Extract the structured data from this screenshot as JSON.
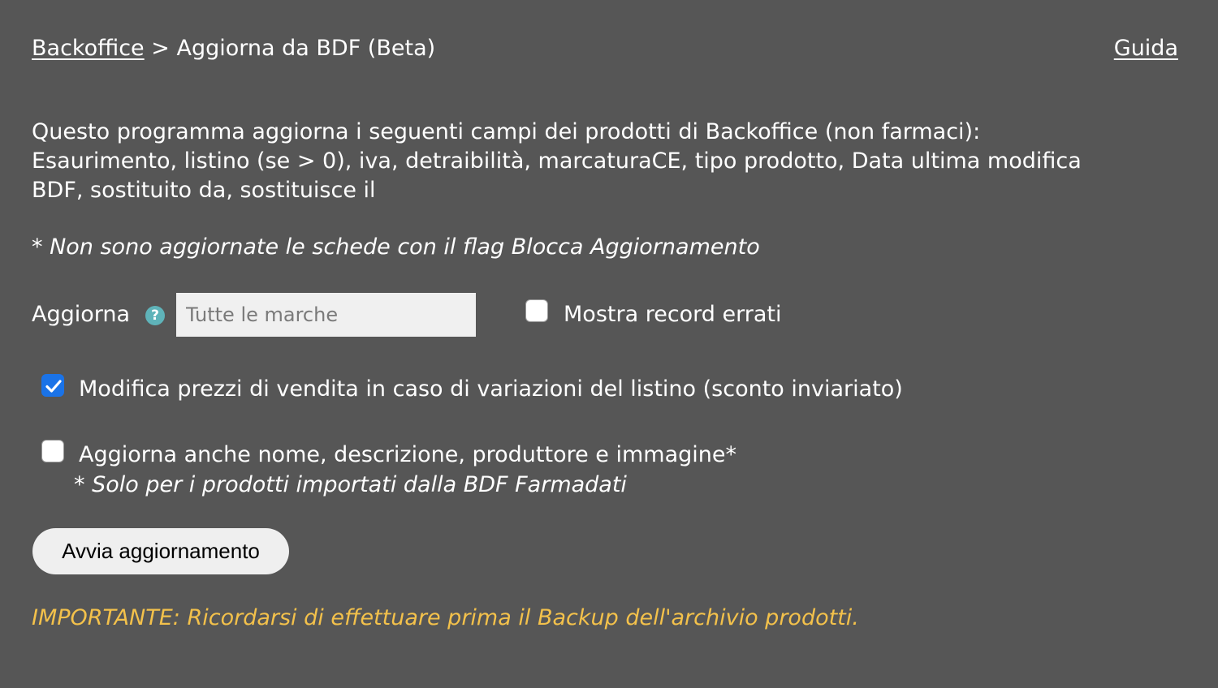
{
  "breadcrumb": {
    "root_label": "Backoffice",
    "separator": ">",
    "current": "Aggiorna da BDF (Beta)"
  },
  "guide_link": "Guida",
  "intro": {
    "line1": "Questo programma aggiorna i seguenti campi dei prodotti di Backoffice (non farmaci):",
    "line2": "Esaurimento, listino (se > 0), iva, detraibilità, marcaturaCE, tipo prodotto, Data ultima modifica",
    "line3": "BDF, sostituito da, sostituisce il"
  },
  "note_block_update": "* Non sono aggiornate le schede con il flag Blocca Aggiornamento",
  "update_row": {
    "label": "Aggiorna",
    "help_icon": "help-icon",
    "help_glyph": "?",
    "brand_placeholder": "Tutte le marche",
    "brand_value": ""
  },
  "options": {
    "show_errors": {
      "label": "Mostra record errati",
      "checked": false
    },
    "modify_prices": {
      "label": "Modifica prezzi di vendita in caso di variazioni del listino (sconto inviariato)",
      "checked": true
    },
    "update_details": {
      "label": "Aggiorna anche nome, descrizione, produttore e immagine*",
      "checked": false
    },
    "update_details_note": "* Solo per i prodotti importati dalla BDF Farmadati"
  },
  "start_button_label": "Avvia aggiornamento",
  "important_text": "IMPORTANTE: Ricordarsi di effettuare prima il Backup dell'archivio prodotti.",
  "colors": {
    "background": "#565656",
    "text": "#ffffff",
    "important": "#f3c14b",
    "checkbox_checked": "#1a73e8",
    "help_icon": "#5fb3b9"
  }
}
